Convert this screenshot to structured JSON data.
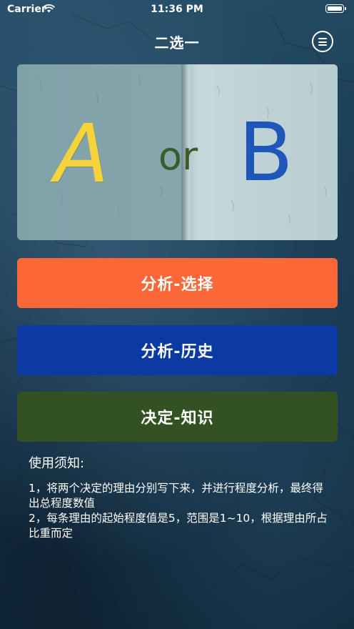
{
  "status_bar": {
    "carrier": "Carrier",
    "time": "11:36 PM"
  },
  "nav": {
    "title": "二选一",
    "menu_icon": "hamburger-menu-icon"
  },
  "banner": {
    "letter_a": "A",
    "word_or": "or",
    "letter_b": "B",
    "colors": {
      "a": "#f5d33a",
      "or": "#3d5a2a",
      "b": "#1e57b8"
    }
  },
  "buttons": [
    {
      "label": "分析-选择",
      "color": "#fc6738"
    },
    {
      "label": "分析-历史",
      "color": "#0b3aa3"
    },
    {
      "label": "决定-知识",
      "color": "#335224"
    }
  ],
  "instructions": {
    "title": "使用须知:",
    "line1": "1，将两个决定的理由分别写下来，并进行程度分析，最终得出总程度数值",
    "line2": "2，每条理由的起始程度值是5，范围是1~10，根据理由所占比重而定"
  }
}
